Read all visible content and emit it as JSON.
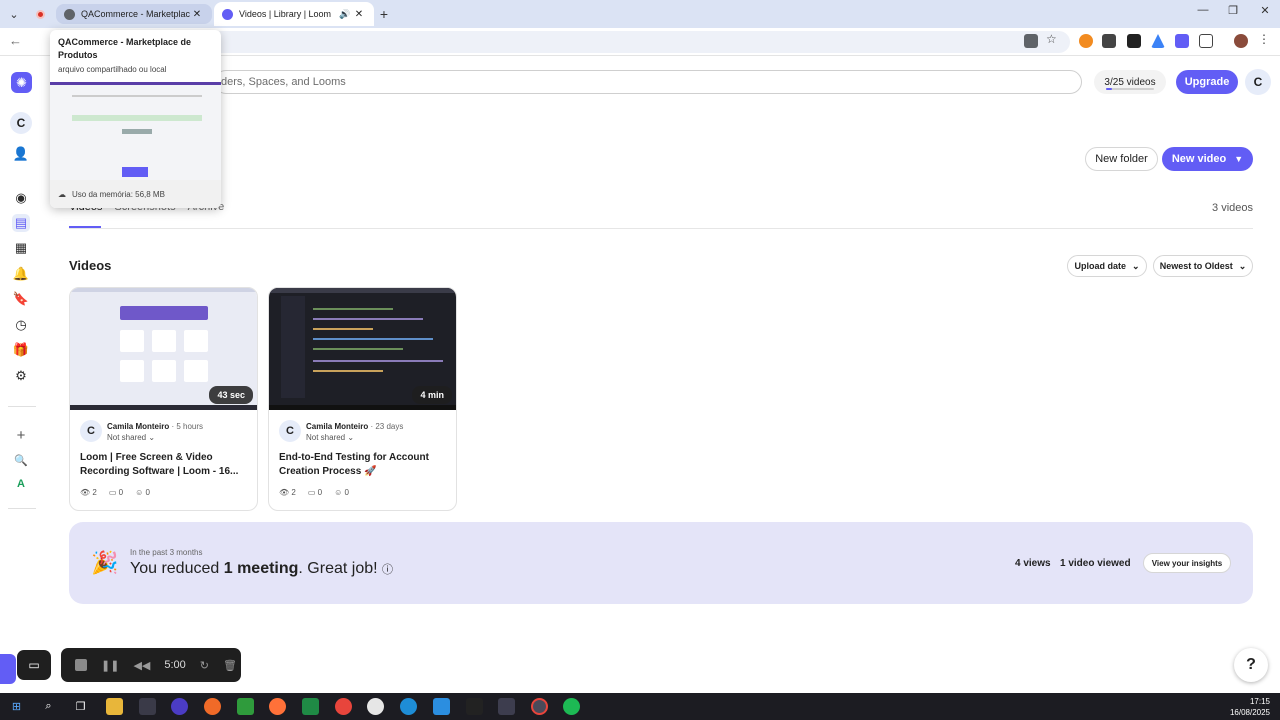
{
  "browser": {
    "tabs": [
      {
        "title": "QACommerce - Marketplace de Produtos",
        "active": false,
        "fav_color": "#5f6368"
      },
      {
        "title": "Videos | Library | Loom",
        "active": true,
        "fav_color": "#625df5"
      }
    ],
    "new_tab_label": "+",
    "preview": {
      "title": "QACommerce - Marketplace de Produtos",
      "subtitle": "arquivo compartilhado ou local",
      "memory": "Uso da memória: 56,8 MB"
    }
  },
  "header": {
    "search_placeholder": "ders, Spaces, and Looms",
    "video_count": "3/25 videos",
    "video_usage_fraction": 0.12,
    "upgrade_label": "Upgrade",
    "avatar_initial": "C"
  },
  "sidebar": {
    "workspace_initial": "C"
  },
  "actions": {
    "new_folder": "New folder",
    "new_video": "New video"
  },
  "library": {
    "tabs": [
      "Videos",
      "Screenshots",
      "Archive"
    ],
    "count_label": "3 videos",
    "section_title": "Videos",
    "sort_by": "Upload date",
    "sort_order": "Newest to Oldest"
  },
  "videos": [
    {
      "owner_initial": "C",
      "owner": "Camila Monteiro",
      "time": "5 hours",
      "shared": "Not shared",
      "title": "Loom | Free Screen & Video Recording Software | Loom - 16...",
      "duration": "43 sec",
      "views": "2",
      "comments": "0",
      "reactions": "0"
    },
    {
      "owner_initial": "C",
      "owner": "Camila Monteiro",
      "time": "23 days",
      "shared": "Not shared",
      "title": "End-to-End Testing for Account Creation Process 🚀",
      "duration": "4 min",
      "views": "2",
      "comments": "0",
      "reactions": "0"
    }
  ],
  "insights": {
    "period": "In the past 3 months",
    "headline_pre": "You reduced ",
    "headline_bold": "1 meeting",
    "headline_post": ". Great job!",
    "views": "4 views",
    "viewed": "1 video viewed",
    "button": "View your insights"
  },
  "recorder": {
    "timer": "5:00"
  },
  "help_label": "?",
  "taskbar": {
    "time": "17:15",
    "date": "16/08/2025"
  },
  "colors": {
    "accent": "#625df5",
    "insights_bg": "#e4e4f8"
  }
}
